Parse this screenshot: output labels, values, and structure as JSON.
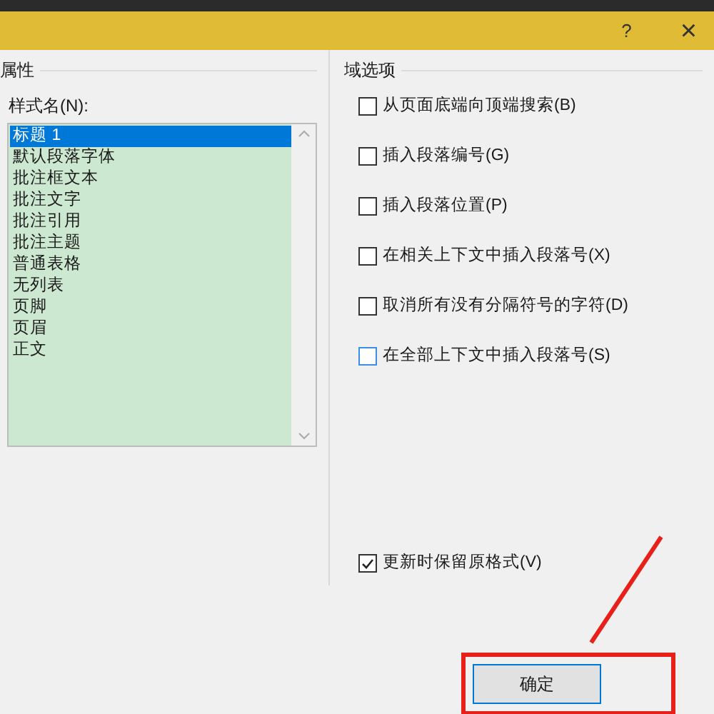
{
  "title_bar": {
    "help": "?",
    "close": "×"
  },
  "left_group": {
    "title": "属性",
    "list_label": "样式名(N):",
    "styles": [
      {
        "label": "标题 1",
        "selected": true
      },
      {
        "label": "默认段落字体",
        "selected": false
      },
      {
        "label": "批注框文本",
        "selected": false
      },
      {
        "label": "批注文字",
        "selected": false
      },
      {
        "label": "批注引用",
        "selected": false
      },
      {
        "label": "批注主题",
        "selected": false
      },
      {
        "label": "普通表格",
        "selected": false
      },
      {
        "label": "无列表",
        "selected": false
      },
      {
        "label": "页脚",
        "selected": false
      },
      {
        "label": "页眉",
        "selected": false
      },
      {
        "label": "正文",
        "selected": false
      }
    ]
  },
  "right_group": {
    "title": "域选项",
    "options": [
      {
        "label": "从页面底端向顶端搜索(B)",
        "checked": false,
        "focused": false
      },
      {
        "label": "插入段落编号(G)",
        "checked": false,
        "focused": false
      },
      {
        "label": "插入段落位置(P)",
        "checked": false,
        "focused": false
      },
      {
        "label": "在相关上下文中插入段落号(X)",
        "checked": false,
        "focused": false
      },
      {
        "label": "取消所有没有分隔符号的字符(D)",
        "checked": false,
        "focused": false
      },
      {
        "label": "在全部上下文中插入段落号(S)",
        "checked": false,
        "focused": true
      }
    ],
    "preserve": {
      "label": "更新时保留原格式(V)",
      "checked": true
    }
  },
  "buttons": [
    {
      "label": "确定"
    }
  ]
}
